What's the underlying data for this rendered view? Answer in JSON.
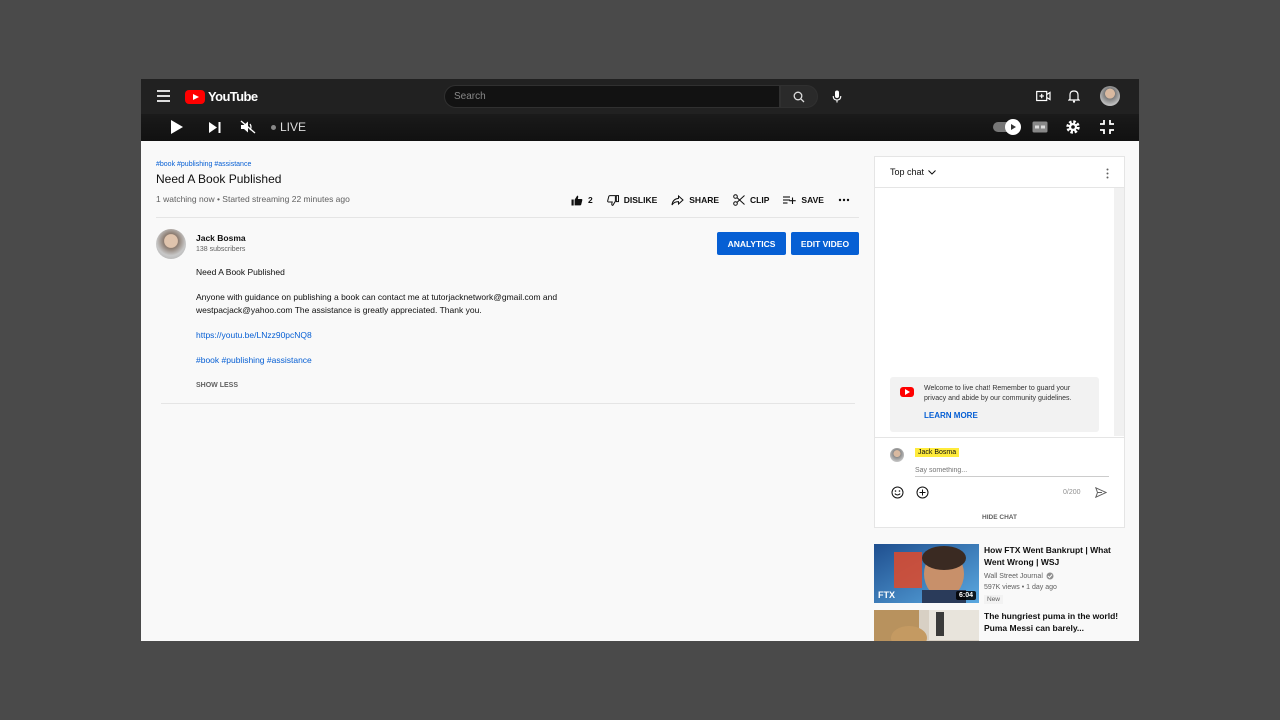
{
  "masthead": {
    "logo_text": "YouTube",
    "search_placeholder": "Search"
  },
  "player": {
    "live_label": "LIVE"
  },
  "video": {
    "hashtags": "#book #publishing #assistance",
    "title": "Need A Book Published",
    "view_info": "1 watching now • Started streaming 22 minutes ago",
    "like_count": "2",
    "dislike_label": "DISLIKE",
    "share_label": "SHARE",
    "clip_label": "CLIP",
    "save_label": "SAVE"
  },
  "channel": {
    "name": "Jack Bosma",
    "subscribers": "138 subscribers",
    "analytics_label": "ANALYTICS",
    "edit_video_label": "EDIT VIDEO"
  },
  "description": {
    "line1": "Need A Book Published",
    "paragraph": "Anyone with guidance on publishing a book can contact me at tutorjacknetwork@gmail.com and westpacjack@yahoo.com The assistance is greatly appreciated. Thank you.",
    "link": "https://youtu.be/LNzz90pcNQ8",
    "tags": "#book #publishing #assistance",
    "show_less": "SHOW LESS"
  },
  "chat": {
    "mode": "Top chat",
    "welcome_text": "Welcome to live chat! Remember to guard your privacy and abide by our community guidelines.",
    "learn_more": "LEARN MORE",
    "username": "Jack Bosma",
    "input_placeholder": "Say something...",
    "char_count": "0/200",
    "hide_chat": "HIDE CHAT"
  },
  "recommendations": [
    {
      "title": "How FTX Went Bankrupt | What Went Wrong | WSJ",
      "channel": "Wall Street Journal",
      "meta": "597K views • 1 day ago",
      "badge": "New",
      "duration": "6:04"
    },
    {
      "title": "The hungriest puma in the world! Puma Messi can barely..."
    }
  ],
  "colors": {
    "accent_blue": "#065fd4",
    "brand_red": "#ff0000",
    "masthead_bg": "#212121"
  }
}
